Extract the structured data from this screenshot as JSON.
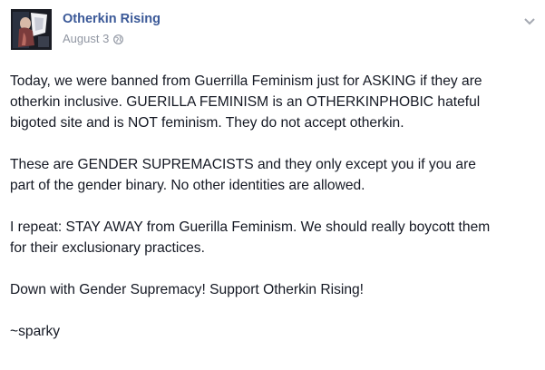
{
  "post": {
    "page_name": "Otherkin Rising",
    "date": "August 3",
    "privacy_icon": "globe-icon",
    "menu_icon": "chevron-down-icon",
    "avatar_icon": "profile-photo",
    "paragraphs": [
      "Today, we were banned from Guerrilla Feminism just for ASKING if they are\notherkin inclusive. GUERILLA FEMINISM is an OTHERKINPHOBIC hateful\nbigoted site and is NOT feminism. They do not accept otherkin.",
      "These are GENDER SUPREMACISTS and they only except you if you are\npart of the gender binary. No other identities are allowed.",
      "I repeat: STAY AWAY from Guerilla Feminism. We should really boycott them\nfor their exclusionary practices.",
      "Down with Gender Supremacy! Support Otherkin Rising!",
      "~sparky"
    ]
  },
  "colors": {
    "link": "#3b5998",
    "text": "#141823",
    "meta": "#9197a3"
  }
}
